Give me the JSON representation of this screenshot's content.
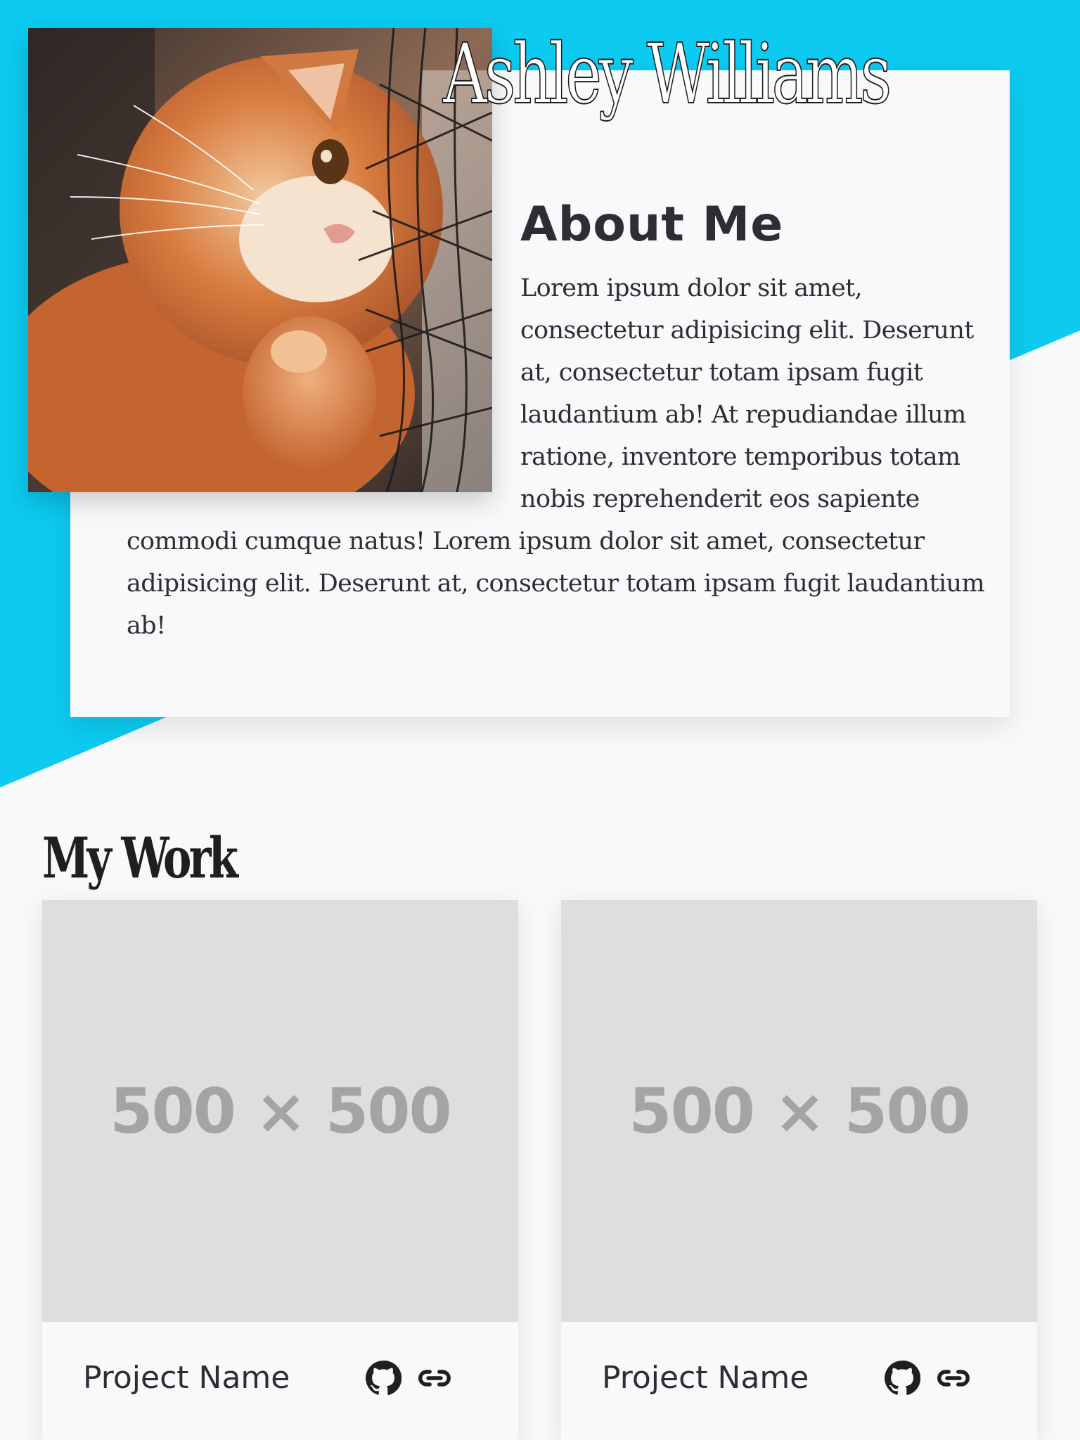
{
  "colors": {
    "accent": "#0ccaf0",
    "background": "#f8f9fb",
    "text": "#2d2e32"
  },
  "header": {
    "name": "Ashley Williams"
  },
  "about": {
    "photo_icon": "cat-photo",
    "heading": "About Me",
    "lines": [
      "Lorem ipsum dolor sit amet,",
      "consectetur adipisicing elit. Deserunt",
      "at, consectetur totam ipsam fugit",
      "laudantium ab! At repudiandae illum",
      "ratione, inventore temporibus totam",
      "nobis reprehenderit eos sapiente",
      "commodi cumque natus! Lorem ipsum dolor sit amet, consectetur",
      "adipisicing elit. Deserunt at, consectetur totam ipsam fugit laudantium",
      "ab!"
    ]
  },
  "work": {
    "heading": "My Work",
    "projects": [
      {
        "thumb": "500 × 500",
        "name": "Project Name",
        "github_icon": "github-icon",
        "link_icon": "link-icon"
      },
      {
        "thumb": "500 × 500",
        "name": "Project Name",
        "github_icon": "github-icon",
        "link_icon": "link-icon"
      }
    ]
  }
}
